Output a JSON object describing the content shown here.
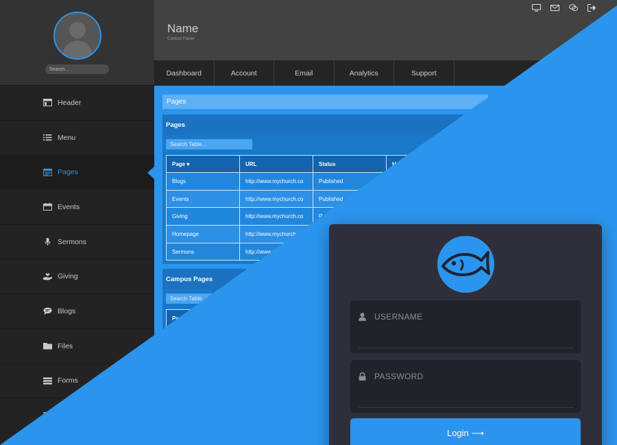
{
  "sidebar": {
    "search_placeholder": "Search...",
    "items": [
      {
        "label": "Header",
        "icon": "layout-icon"
      },
      {
        "label": "Menu",
        "icon": "list-icon"
      },
      {
        "label": "Pages",
        "icon": "browser-icon",
        "active": true
      },
      {
        "label": "Events",
        "icon": "calendar-icon"
      },
      {
        "label": "Sermons",
        "icon": "microphone-icon"
      },
      {
        "label": "Giving",
        "icon": "hand-heart-icon"
      },
      {
        "label": "Blogs",
        "icon": "chat-bubble-icon"
      },
      {
        "label": "Files",
        "icon": "folder-icon"
      },
      {
        "label": "Forms",
        "icon": "form-icon"
      }
    ]
  },
  "header": {
    "title": "Name",
    "subtitle": "Control Panel",
    "icons": [
      "monitor-icon",
      "mail-icon",
      "chat-icon",
      "logout-icon"
    ]
  },
  "tabs": [
    "Dashboard",
    "Account",
    "Email",
    "Analytics",
    "Support"
  ],
  "main": {
    "breadcrumb": "Pages",
    "pages_panel": {
      "title": "Pages",
      "search_placeholder": "Search Table...",
      "columns": [
        "Page ▾",
        "URL",
        "Status",
        "H"
      ],
      "rows": [
        [
          "Blogs",
          "http://www.mychurch.co",
          "Published",
          ""
        ],
        [
          "Events",
          "http://www.mychurch.co",
          "Published",
          ""
        ],
        [
          "Giving",
          "http://www.mychurch.co",
          "P",
          ""
        ],
        [
          "Homepage",
          "http://www.mychurch.co",
          "",
          ""
        ],
        [
          "Sermons",
          "http://www.mychurch.co",
          "",
          ""
        ]
      ]
    },
    "campus_panel": {
      "title": "Campus Pages",
      "search_placeholder": "Search Table...",
      "first_column": "Page"
    }
  },
  "login": {
    "logo": "fish-icon",
    "username_placeholder": "USERNAME",
    "password_placeholder": "PASSWORD",
    "button_label": "Login ⟶"
  },
  "colors": {
    "accent": "#2b95ee",
    "sidebar_bg": "#232323",
    "login_card_bg": "#2f2f3b"
  }
}
